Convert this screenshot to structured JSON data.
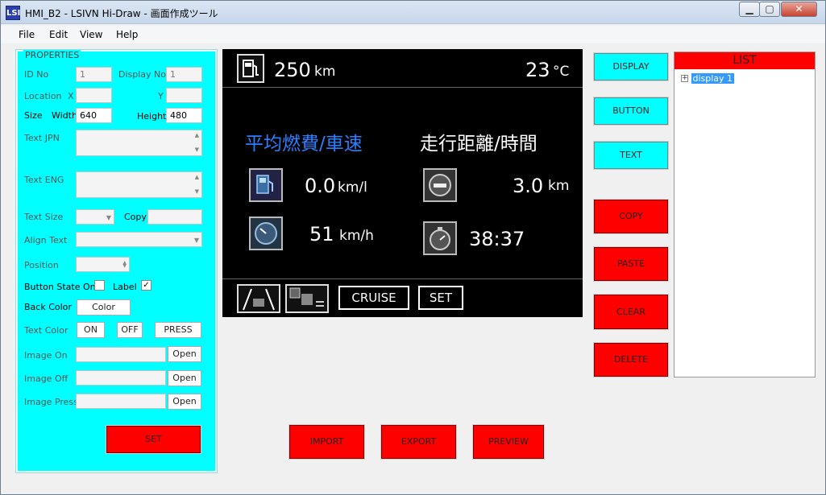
{
  "window": {
    "title": "HMI_B2 - LSIVN Hi-Draw - 画面作成ツール",
    "app_icon": "LSI",
    "minimize": "▁",
    "maximize": "▢",
    "close": "✕"
  },
  "menu": [
    "File",
    "Edit",
    "View",
    "Help"
  ],
  "properties": {
    "legend": "PROPERTIES",
    "id_no_label": "ID No",
    "id_no_value": "1",
    "display_no_label": "Display No",
    "display_no_value": "1",
    "location_label": "Location",
    "x_label": "X",
    "y_label": "Y",
    "size_label": "Size",
    "width_label": "Width",
    "width_value": "640",
    "height_label": "Height",
    "height_value": "480",
    "text_jpn_label": "Text JPN",
    "text_eng_label": "Text ENG",
    "text_size_label": "Text Size",
    "copy_label": "Copy",
    "align_text_label": "Align Text",
    "position_label": "Position",
    "button_state_label": "Button State On",
    "label_label": "Label",
    "back_color_label": "Back Color",
    "color_button": "Color",
    "text_color_label": "Text Color",
    "on_button": "ON",
    "off_button": "OFF",
    "press_button": "PRESS",
    "image_on_label": "Image On",
    "image_off_label": "Image Off",
    "image_press_label": "Image Press",
    "open_button": "Open",
    "set_button": "SET"
  },
  "hmi": {
    "range_value": "250",
    "range_unit": "km",
    "temp_value": "23",
    "temp_unit": "°C",
    "avg_title": "平均燃費/車速",
    "trip_title": "走行距離/時間",
    "fuel_eff_value": "0.0",
    "fuel_eff_unit": "km/l",
    "distance_value": "3.0",
    "distance_unit": "km",
    "speed_value": "51",
    "speed_unit": "km/h",
    "time_value": "38:37",
    "cruise_label": "CRUISE",
    "set_label": "SET",
    "accent_blue": "#2b7fff"
  },
  "bottom_buttons": {
    "import": "IMPORT",
    "export": "EXPORT",
    "preview": "PREVIEW"
  },
  "tool_buttons": {
    "display": "DISPLAY",
    "button": "BUTTON",
    "text": "TEXT",
    "copy": "COPY",
    "paste": "PASTE",
    "clear": "CLEAR",
    "delete": "DELETE"
  },
  "list": {
    "title": "LIST",
    "expander": "+",
    "items": [
      "display 1"
    ]
  },
  "colors": {
    "properties_bg": "#00ffff",
    "red_button": "#ff0000",
    "cyan_button": "#00ffff",
    "canvas_bg": "#000000"
  }
}
